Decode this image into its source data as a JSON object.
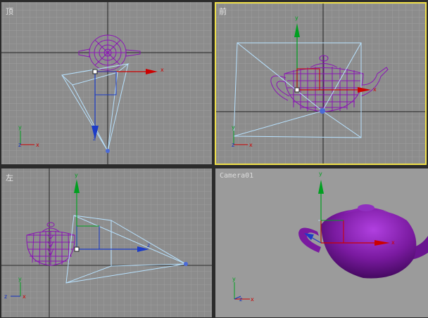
{
  "viewports": {
    "top": {
      "label": "顶",
      "active": false
    },
    "front": {
      "label": "前",
      "active": true
    },
    "left": {
      "label": "左",
      "active": false
    },
    "camera": {
      "label": "Camera01",
      "active": false
    }
  },
  "axis_labels": {
    "x": "x",
    "y": "y",
    "z": "z"
  },
  "colors": {
    "viewport_bg": "#8c8c8c",
    "camera_bg": "#9b9b9b",
    "grid_line": "#a3a3a3",
    "grid_major": "#222222",
    "active_border": "#f0e04a",
    "teapot_wire": "#8a16b4",
    "teapot_solid": "#7a1aa0",
    "frustum": "#b8e2ff",
    "gizmo_x": "#cc0000",
    "gizmo_y": "#00a020",
    "gizmo_z": "#1c3cc8",
    "corner_axis_x": "#cc0000",
    "corner_axis_y": "#00a020",
    "corner_axis_z": "#1030c0"
  }
}
